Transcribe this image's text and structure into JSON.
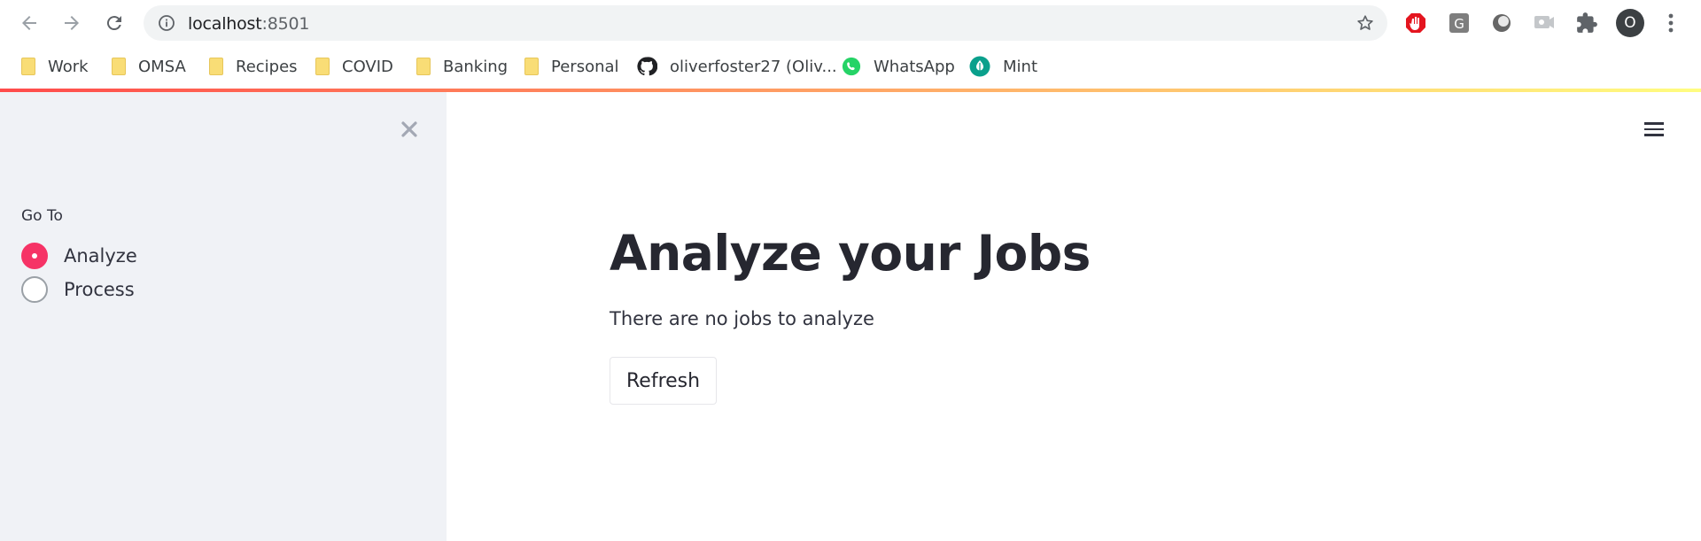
{
  "browser": {
    "url_host": "localhost",
    "url_port": ":8501",
    "profile_initial": "O",
    "extensions": [
      "adblock-icon",
      "grammarly-icon",
      "circle-extension-icon",
      "screen-extension-icon",
      "puzzle-icon"
    ]
  },
  "bookmarks": [
    {
      "label": "Work",
      "icon": "folder-icon"
    },
    {
      "label": "OMSA",
      "icon": "folder-icon"
    },
    {
      "label": "Recipes",
      "icon": "folder-icon"
    },
    {
      "label": "COVID",
      "icon": "folder-icon"
    },
    {
      "label": "Banking",
      "icon": "folder-icon"
    },
    {
      "label": "Personal",
      "icon": "folder-icon"
    },
    {
      "label": "oliverfoster27 (Oliv...",
      "icon": "github-icon"
    },
    {
      "label": "WhatsApp",
      "icon": "whatsapp-icon"
    },
    {
      "label": "Mint",
      "icon": "mint-icon"
    }
  ],
  "sidebar": {
    "radio_label": "Go To",
    "options": [
      {
        "label": "Analyze",
        "selected": true
      },
      {
        "label": "Process",
        "selected": false
      }
    ]
  },
  "main": {
    "title": "Analyze your Jobs",
    "message": "There are no jobs to analyze",
    "refresh_label": "Refresh"
  },
  "colors": {
    "accent": "#f63366",
    "sidebar_bg": "#f0f2f6",
    "decoration_start": "#ff4b4b",
    "decoration_end": "#fffd80"
  }
}
